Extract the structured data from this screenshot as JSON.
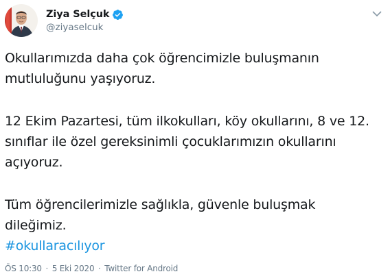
{
  "tweet": {
    "display_name": "Ziya Selçuk",
    "handle": "@ziyaselcuk",
    "paragraph_1": [
      "Okullarımızda daha çok öğrencimizle buluşmanın",
      "mutluluğunu yaşıyoruz."
    ],
    "paragraph_2": [
      "12 Ekim Pazartesi, tüm ilkokulları, köy okullarını, 8 ve 12.",
      "sınıflar ile özel gereksinimli çocuklarımızın okullarını",
      "açıyoruz."
    ],
    "paragraph_3": [
      "Tüm öğrencilerimizle sağlıkla, güvenle buluşmak",
      "dileğimiz."
    ],
    "hashtag": "#okullaracılıyor",
    "time": "ÖS 10:30",
    "date": "5 Eki 2020",
    "source": "Twitter for Android",
    "separator": "·"
  },
  "icons": {
    "verified": "verified-badge-icon",
    "caret": "chevron-down-icon"
  },
  "colors": {
    "link": "#1b95e0",
    "verified": "#1da1f2",
    "secondary_text": "#657786",
    "primary_text": "#14171a"
  }
}
